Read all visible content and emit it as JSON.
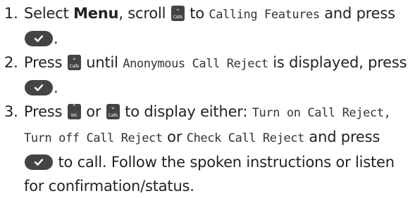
{
  "steps": [
    {
      "num": "1.",
      "t1": "Select ",
      "t2": "Menu",
      "t3": ", scroll ",
      "key": "Calls",
      "t4": " to ",
      "lcd": "Calling Features",
      "t5": " and press ",
      "t6": "."
    },
    {
      "num": "2.",
      "t1": "Press ",
      "key": "Calls",
      "t2": " until ",
      "lcd": "Anonymous Call Reject",
      "t3": " is displayed, press ",
      "t4": "."
    },
    {
      "num": "3.",
      "t1": "Press ",
      "key1": "Vol.",
      "t2": " or ",
      "key2": "Calls",
      "t3": " to display either: ",
      "lcd1": "Turn on Call Reject,",
      "t4": " ",
      "lcd2": "Turn off Call Reject",
      "t5": " or ",
      "lcd3": "Check Call Reject",
      "t6": " and press ",
      "t7": " to call. Follow the spoken instructions or listen for confirmation/status."
    }
  ],
  "icons": {
    "key_color": "#444444",
    "calls_key_icon": "chevron-down-icon",
    "vol_key_icon": "chevron-up-icon",
    "ok_key_icon": "checkmark-icon"
  }
}
